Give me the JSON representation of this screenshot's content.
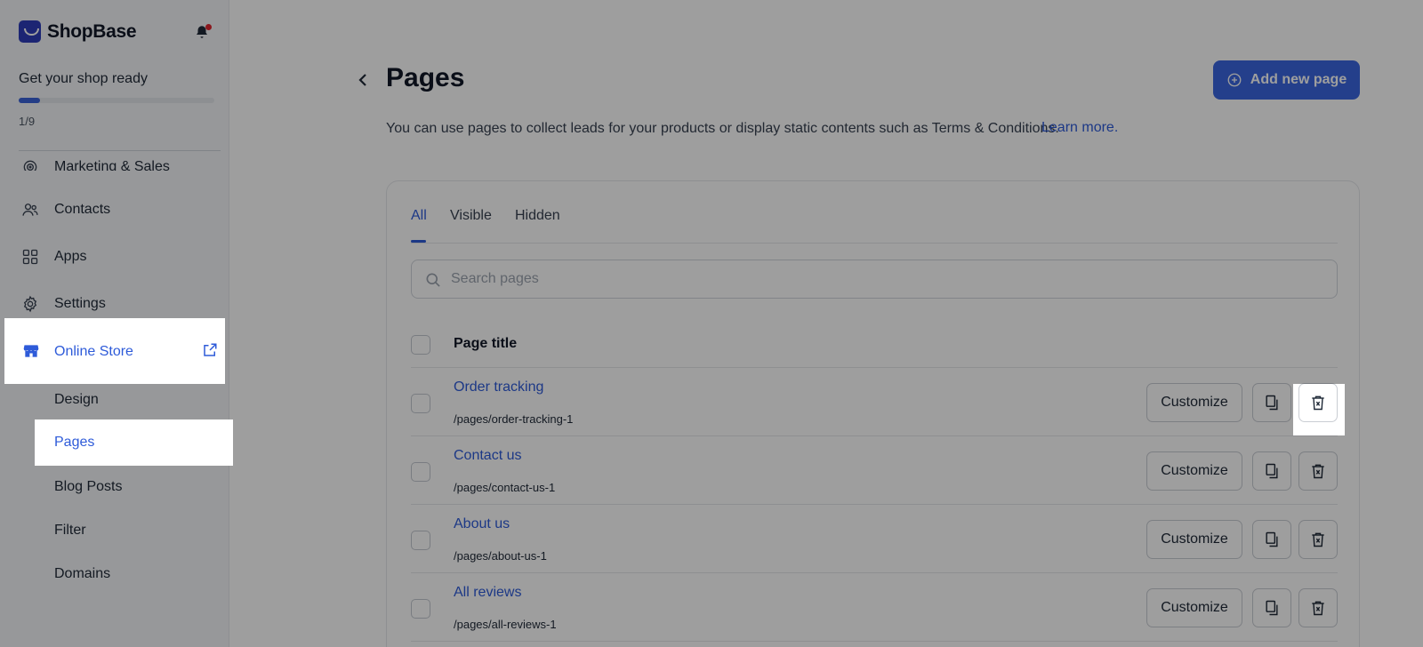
{
  "brand": {
    "name": "ShopBase"
  },
  "sidebar": {
    "ready_title": "Get your shop ready",
    "progress": {
      "done": 1,
      "total": 9,
      "label": "1/9"
    },
    "nav": [
      {
        "label": "Marketing & Sales",
        "icon": "target-icon"
      },
      {
        "label": "Contacts",
        "icon": "users-icon"
      },
      {
        "label": "Apps",
        "icon": "apps-grid-icon"
      },
      {
        "label": "Settings",
        "icon": "gear-icon"
      }
    ],
    "online_store": {
      "label": "Online Store",
      "icon": "store-icon",
      "external_icon": "external-link-icon"
    },
    "sub_items": [
      {
        "label": "Design"
      },
      {
        "label": "Pages",
        "active": true
      },
      {
        "label": "Blog Posts"
      },
      {
        "label": "Filter"
      },
      {
        "label": "Domains"
      }
    ]
  },
  "header": {
    "title": "Pages",
    "description": "You can use pages to collect leads for your products or display static contents such as Terms & Conditions.",
    "learn_more": "Learn more.",
    "add_button": "Add new page"
  },
  "tabs": [
    {
      "label": "All",
      "active": true
    },
    {
      "label": "Visible"
    },
    {
      "label": "Hidden"
    }
  ],
  "search": {
    "placeholder": "Search pages",
    "value": ""
  },
  "table": {
    "column_title": "Page title",
    "rows": [
      {
        "title": "Order tracking",
        "url": "/pages/order-tracking-1"
      },
      {
        "title": "Contact us",
        "url": "/pages/contact-us-1"
      },
      {
        "title": "About us",
        "url": "/pages/about-us-1"
      },
      {
        "title": "All reviews",
        "url": "/pages/all-reviews-1"
      }
    ],
    "customize_label": "Customize"
  },
  "colors": {
    "accent": "#2e5bd9",
    "brand": "#2e3cba",
    "notification": "#e0262f"
  }
}
